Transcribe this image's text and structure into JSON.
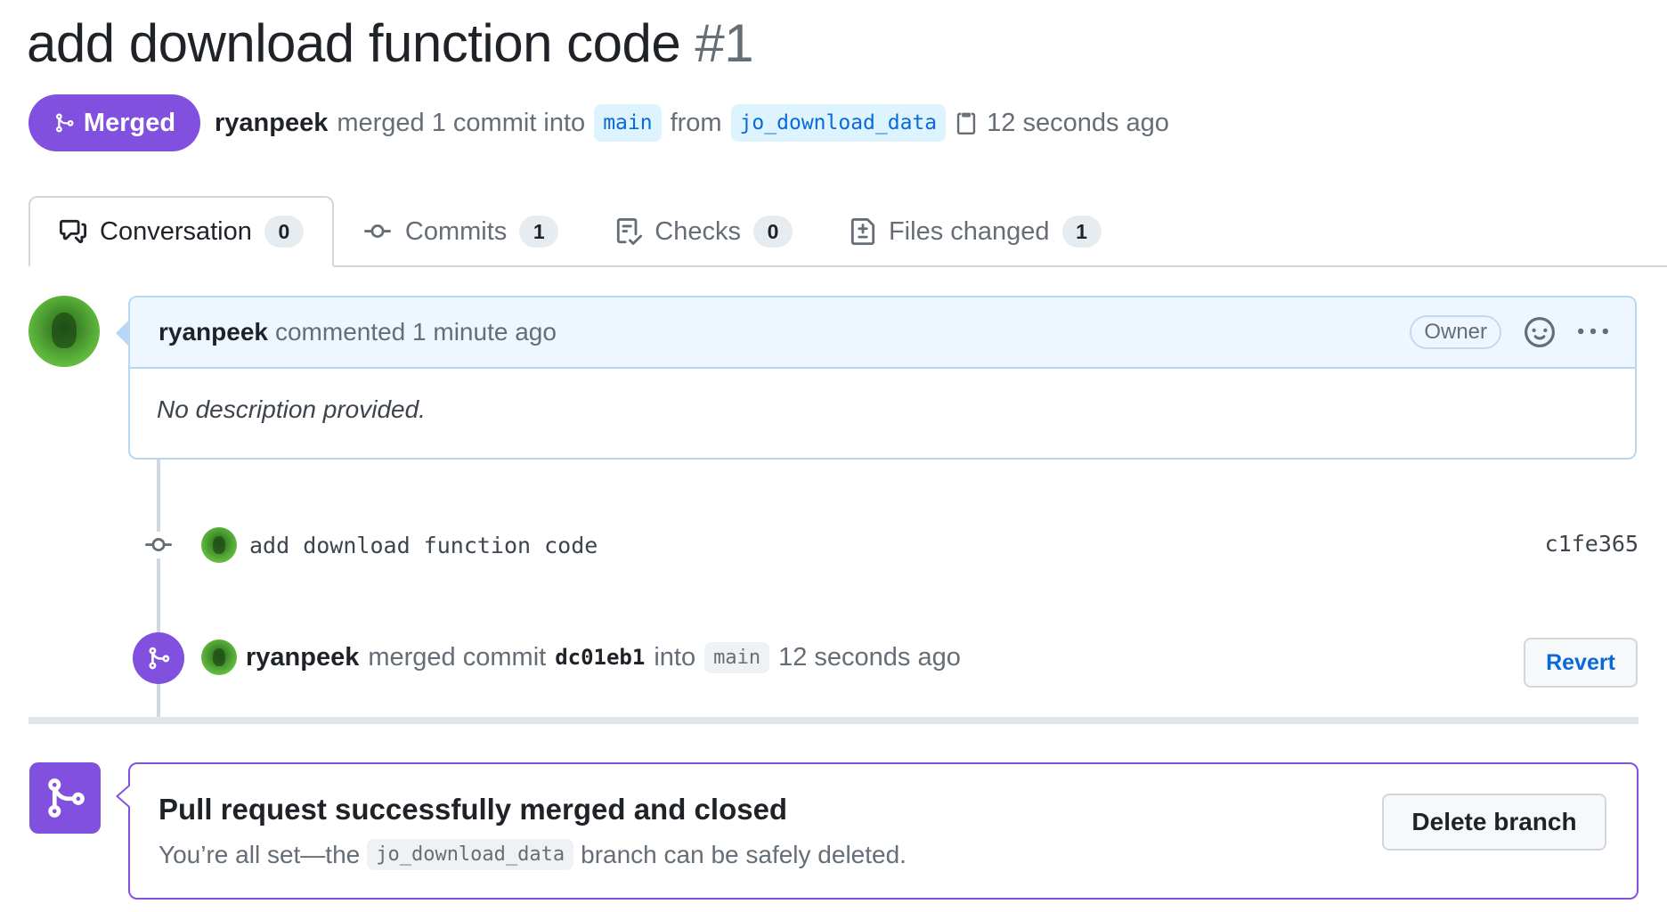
{
  "pr": {
    "title": "add download function code",
    "number": "#1",
    "state_label": "Merged",
    "author": "ryanpeek",
    "merge_text": "merged 1 commit into",
    "base_branch": "main",
    "from_text": "from",
    "head_branch": "jo_download_data",
    "time": "12 seconds ago"
  },
  "tabs": [
    {
      "label": "Conversation",
      "count": "0",
      "icon": "comment-discussion-icon"
    },
    {
      "label": "Commits",
      "count": "1",
      "icon": "git-commit-icon"
    },
    {
      "label": "Checks",
      "count": "0",
      "icon": "checklist-icon"
    },
    {
      "label": "Files changed",
      "count": "1",
      "icon": "file-diff-icon"
    }
  ],
  "comment": {
    "author": "ryanpeek",
    "action": "commented 1 minute ago",
    "role": "Owner",
    "body": "No description provided."
  },
  "timeline": {
    "commit_message": "add download function code",
    "commit_sha": "c1fe365",
    "merge_author": "ryanpeek",
    "merge_text": "merged commit",
    "merge_sha": "dc01eb1",
    "into_text": "into",
    "into_branch": "main",
    "merge_time": "12 seconds ago",
    "revert_label": "Revert"
  },
  "mergebox": {
    "title": "Pull request successfully merged and closed",
    "sub_prefix": "You’re all set—the",
    "branch": "jo_download_data",
    "sub_suffix": "branch can be safely deleted.",
    "delete_label": "Delete branch"
  },
  "colors": {
    "merged_purple": "#8250df",
    "link_blue": "#0969da",
    "muted": "#656d76"
  }
}
